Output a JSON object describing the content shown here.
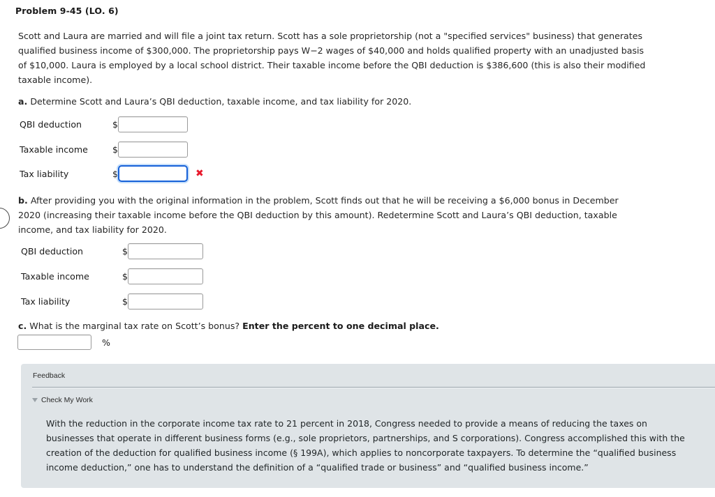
{
  "problem": {
    "title": "Problem 9-45 (LO. 6)",
    "intro": "Scott and Laura are married and will file a joint tax return. Scott has a sole proprietorship (not a \"specified services\" business) that generates qualified business income of $300,000. The proprietorship pays W−2 wages of $40,000 and holds qualified property with an unadjusted basis of $10,000. Laura is employed by a local school district. Their taxable income before the QBI deduction is $386,600 (this is also their modified taxable income)."
  },
  "parts": {
    "a": {
      "marker": "a.",
      "text": "Determine Scott and Laura’s QBI deduction, taxable income, and tax liability for 2020.",
      "rows": [
        {
          "label": "QBI deduction",
          "prefix": "$",
          "value": "",
          "state": "normal"
        },
        {
          "label": "Taxable income",
          "prefix": "$",
          "value": "",
          "state": "normal"
        },
        {
          "label": "Tax liability",
          "prefix": "$",
          "value": "",
          "state": "incorrect",
          "mark": "✖"
        }
      ]
    },
    "b": {
      "marker": "b.",
      "text": "After providing you with the original information in the problem, Scott finds out that he will be receiving a $6,000 bonus in December 2020 (increasing their taxable income before the QBI deduction by this amount). Redetermine Scott and Laura’s QBI deduction, taxable income, and tax liability for 2020.",
      "rows": [
        {
          "label": "QBI deduction",
          "prefix": "$",
          "value": "",
          "state": "normal"
        },
        {
          "label": "Taxable income",
          "prefix": "$",
          "value": "",
          "state": "normal"
        },
        {
          "label": "Tax liability",
          "prefix": "$",
          "value": "",
          "state": "normal"
        }
      ]
    },
    "c": {
      "marker": "c.",
      "text": "What is the marginal tax rate on Scott’s bonus?",
      "emphasis": "Enter the percent to one decimal place.",
      "input_value": "",
      "suffix": "%"
    }
  },
  "feedback": {
    "title": "Feedback",
    "toggle_label": "Check My Work",
    "toggle_icon": "triangle-down-icon",
    "body": "With the reduction in the corporate income tax rate to 21 percent in 2018, Congress needed to provide a means of reducing the taxes on businesses that operate in different business forms (e.g., sole proprietors, partnerships, and S corporations). Congress accomplished this with the creation of the deduction for qualified business income (§ 199A), which applies to noncorporate taxpayers. To determine the “qualified business income deduction,” one has to understand the definition of a “qualified trade or business” and “qualified business income.”"
  },
  "colors": {
    "focus_border": "#1560d8",
    "error_mark": "#e8192c",
    "feedback_bg": "#dfe4e7",
    "field_border": "#9a9a9a"
  }
}
